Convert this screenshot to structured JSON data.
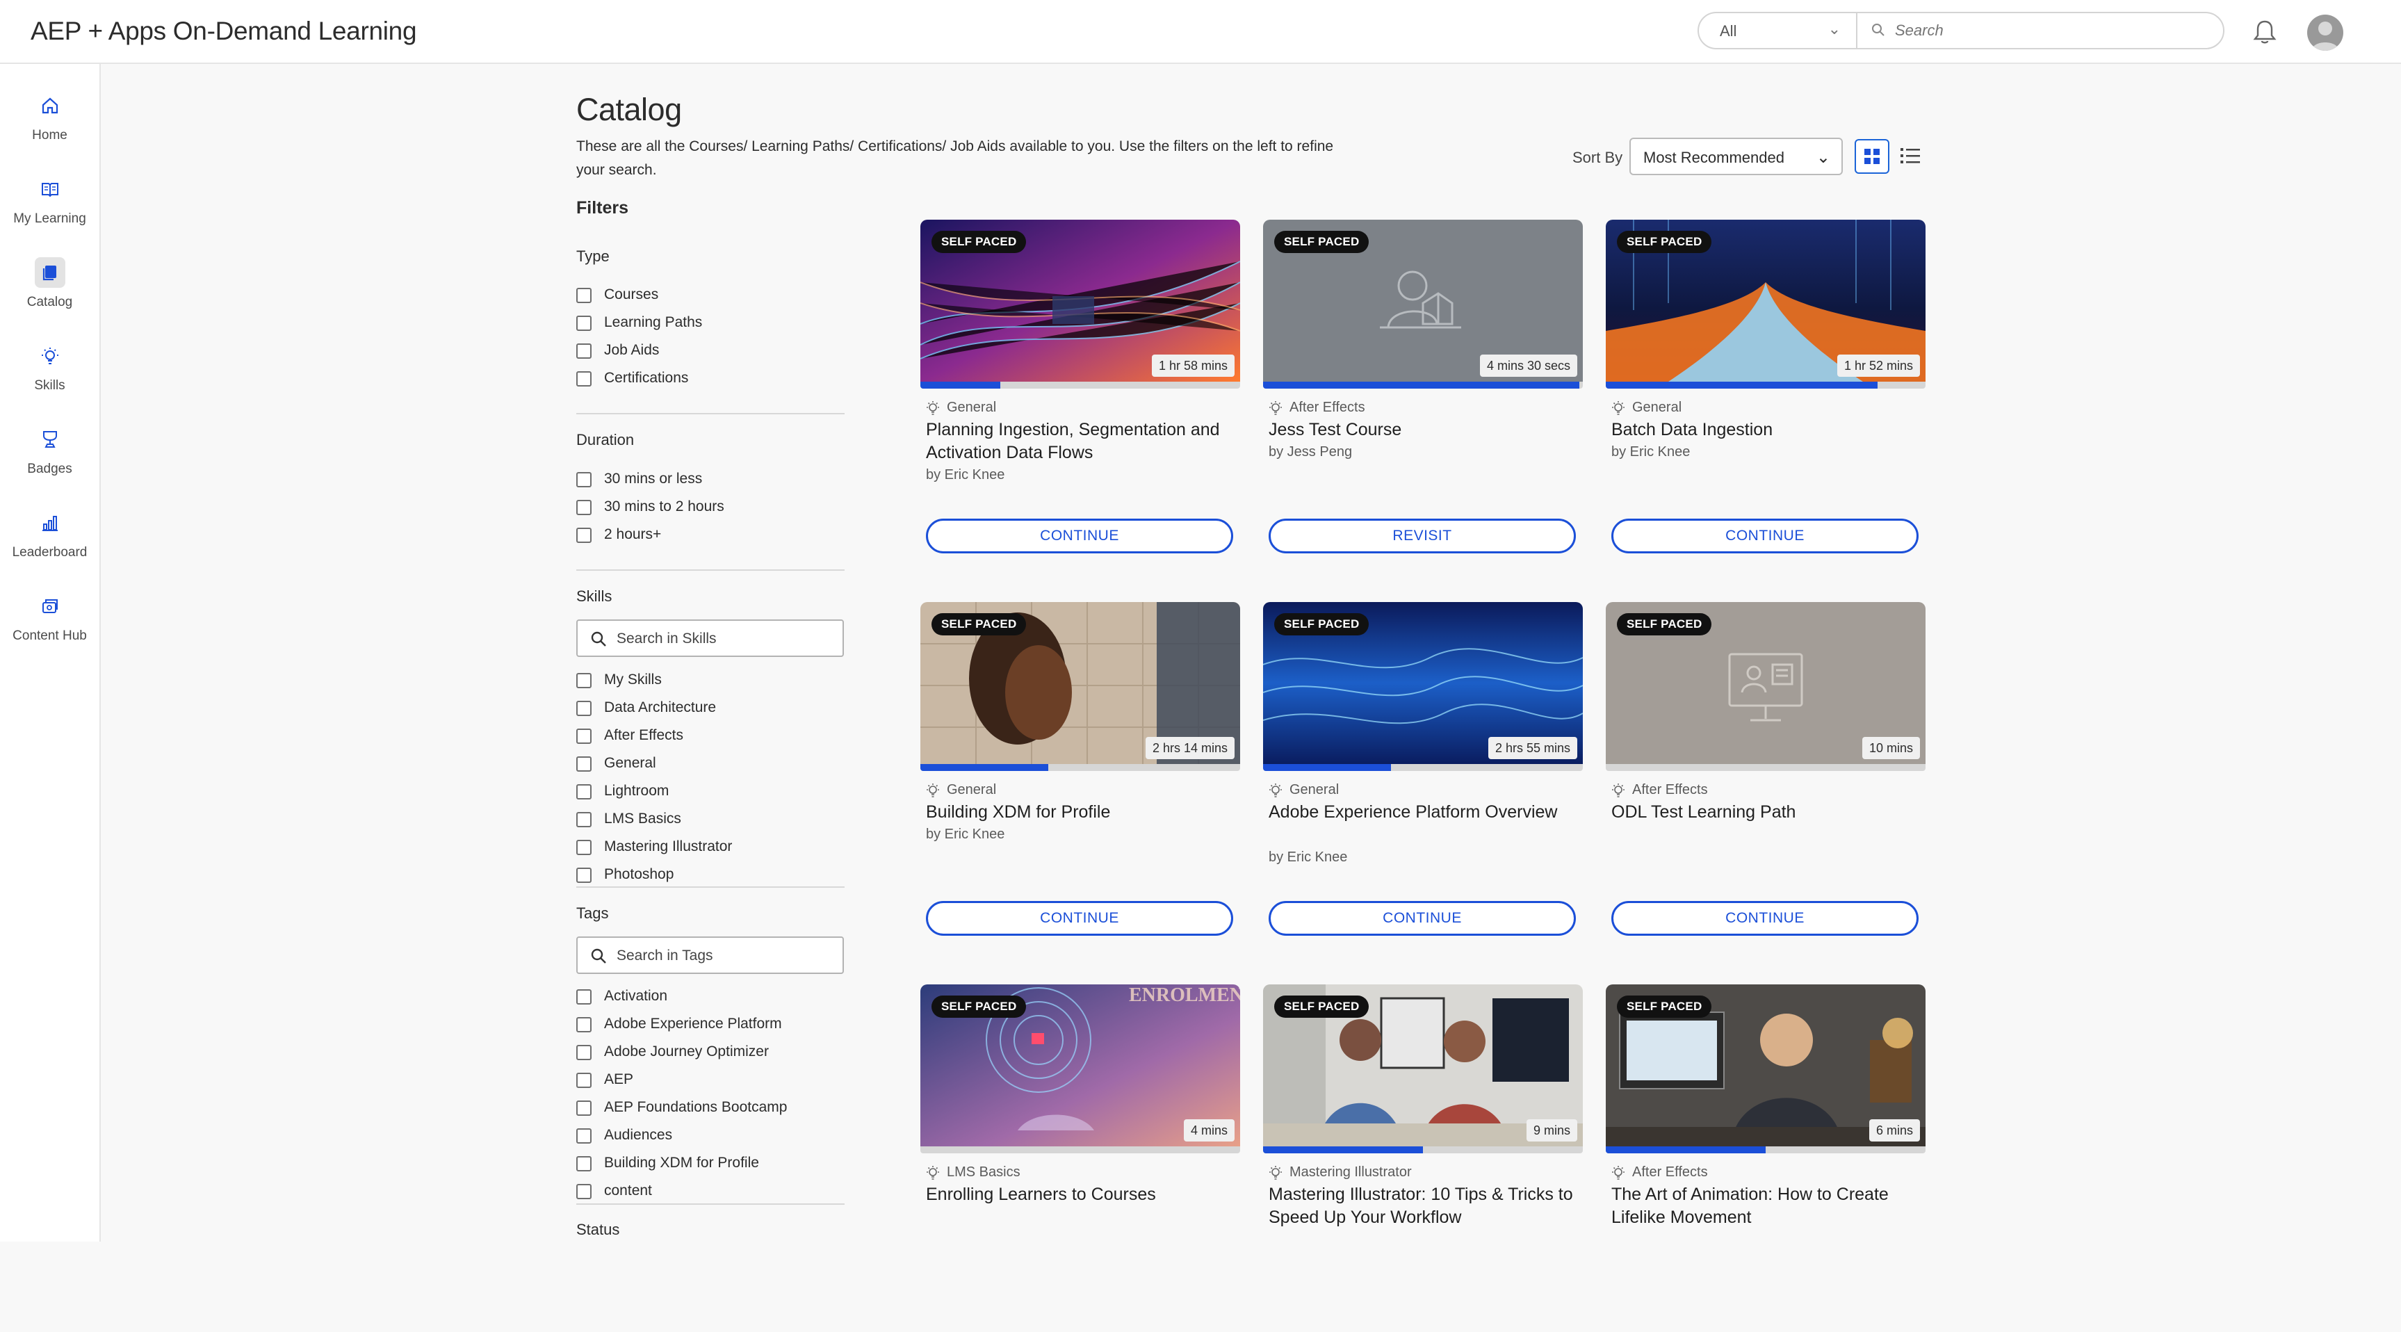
{
  "header": {
    "app_title": "AEP + Apps On-Demand Learning",
    "search_scope": "All",
    "search_placeholder": "Search"
  },
  "nav": [
    {
      "label": "Home",
      "icon": "home-icon"
    },
    {
      "label": "My Learning",
      "icon": "book-icon"
    },
    {
      "label": "Catalog",
      "icon": "catalog-icon",
      "active": true
    },
    {
      "label": "Skills",
      "icon": "lightbulb-icon"
    },
    {
      "label": "Badges",
      "icon": "badge-icon"
    },
    {
      "label": "Leaderboard",
      "icon": "leaderboard-icon"
    },
    {
      "label": "Content Hub",
      "icon": "content-hub-icon"
    }
  ],
  "main": {
    "title": "Catalog",
    "description": "These are all the Courses/ Learning Paths/ Certifications/ Job Aids available to you. Use the filters on the left to refine your search.",
    "sort_label": "Sort By",
    "sort_value": "Most Recommended"
  },
  "filters": {
    "title": "Filters",
    "type": {
      "title": "Type",
      "options": [
        "Courses",
        "Learning Paths",
        "Job Aids",
        "Certifications"
      ]
    },
    "duration": {
      "title": "Duration",
      "options": [
        "30 mins or less",
        "30 mins to 2 hours",
        "2 hours+"
      ]
    },
    "skills": {
      "title": "Skills",
      "search_placeholder": "Search in Skills",
      "options": [
        "My Skills",
        "Data Architecture",
        "After Effects",
        "General",
        "Lightroom",
        "LMS Basics",
        "Mastering Illustrator",
        "Photoshop"
      ]
    },
    "tags": {
      "title": "Tags",
      "search_placeholder": "Search in Tags",
      "options": [
        "Activation",
        "Adobe Experience Platform",
        "Adobe Journey Optimizer",
        "AEP",
        "AEP Foundations Bootcamp",
        "Audiences",
        "Building XDM for Profile",
        "content"
      ]
    },
    "status": {
      "title": "Status"
    }
  },
  "cards": [
    {
      "badge": "SELF PACED",
      "duration": "1 hr 58 mins",
      "skill": "General",
      "title": "Planning Ingestion, Segmentation and Activation Data Flows",
      "author": "by Eric Knee",
      "button": "CONTINUE",
      "progress": 0.25,
      "thumb": "data-lines"
    },
    {
      "badge": "SELF PACED",
      "duration": "4 mins 30 secs",
      "skill": "After Effects",
      "title": "Jess Test Course",
      "author": "by Jess Peng",
      "button": "REVISIT",
      "progress": 0.99,
      "thumb": "placeholder-reader"
    },
    {
      "badge": "SELF PACED",
      "duration": "1 hr 52 mins",
      "skill": "General",
      "title": "Batch Data Ingestion",
      "author": "by Eric Knee",
      "button": "CONTINUE",
      "progress": 0.85,
      "thumb": "data-river"
    },
    {
      "badge": "SELF PACED",
      "duration": "2 hrs 14 mins",
      "skill": "General",
      "title": "Building XDM for Profile",
      "author": "by Eric Knee",
      "button": "CONTINUE",
      "progress": 0.4,
      "thumb": "puzzle-face"
    },
    {
      "badge": "SELF PACED",
      "duration": "2 hrs 55 mins",
      "skill": "General",
      "title": "Adobe Experience Platform Overview",
      "author": "by Eric Knee",
      "button": "CONTINUE",
      "progress": 0.4,
      "thumb": "blue-waves"
    },
    {
      "badge": "SELF PACED",
      "duration": "10 mins",
      "skill": "After Effects",
      "title": "ODL Test Learning Path",
      "author": "",
      "button": "CONTINUE",
      "progress": 0,
      "thumb": "placeholder-presenter"
    },
    {
      "badge": "SELF PACED",
      "duration": "4 mins",
      "skill": "LMS Basics",
      "title": "Enrolling Learners to Courses",
      "author": "",
      "button": "CONTINUE",
      "progress": 0,
      "thumb": "enrolment",
      "thumb_text": "ENROLMENT"
    },
    {
      "badge": "SELF PACED",
      "duration": "9 mins",
      "skill": "Mastering Illustrator",
      "title": "Mastering Illustrator: 10 Tips & Tricks to Speed Up Your Workflow",
      "author": "",
      "button": "CONTINUE",
      "progress": 0.5,
      "thumb": "two-presenters"
    },
    {
      "badge": "SELF PACED",
      "duration": "6 mins",
      "skill": "After Effects",
      "title": "The Art of Animation: How to Create Lifelike Movement",
      "author": "",
      "button": "CONTINUE",
      "progress": 0.5,
      "thumb": "presenter-desk"
    }
  ],
  "colors": {
    "accent": "#1b4fd8",
    "badge_bg": "#111111"
  }
}
